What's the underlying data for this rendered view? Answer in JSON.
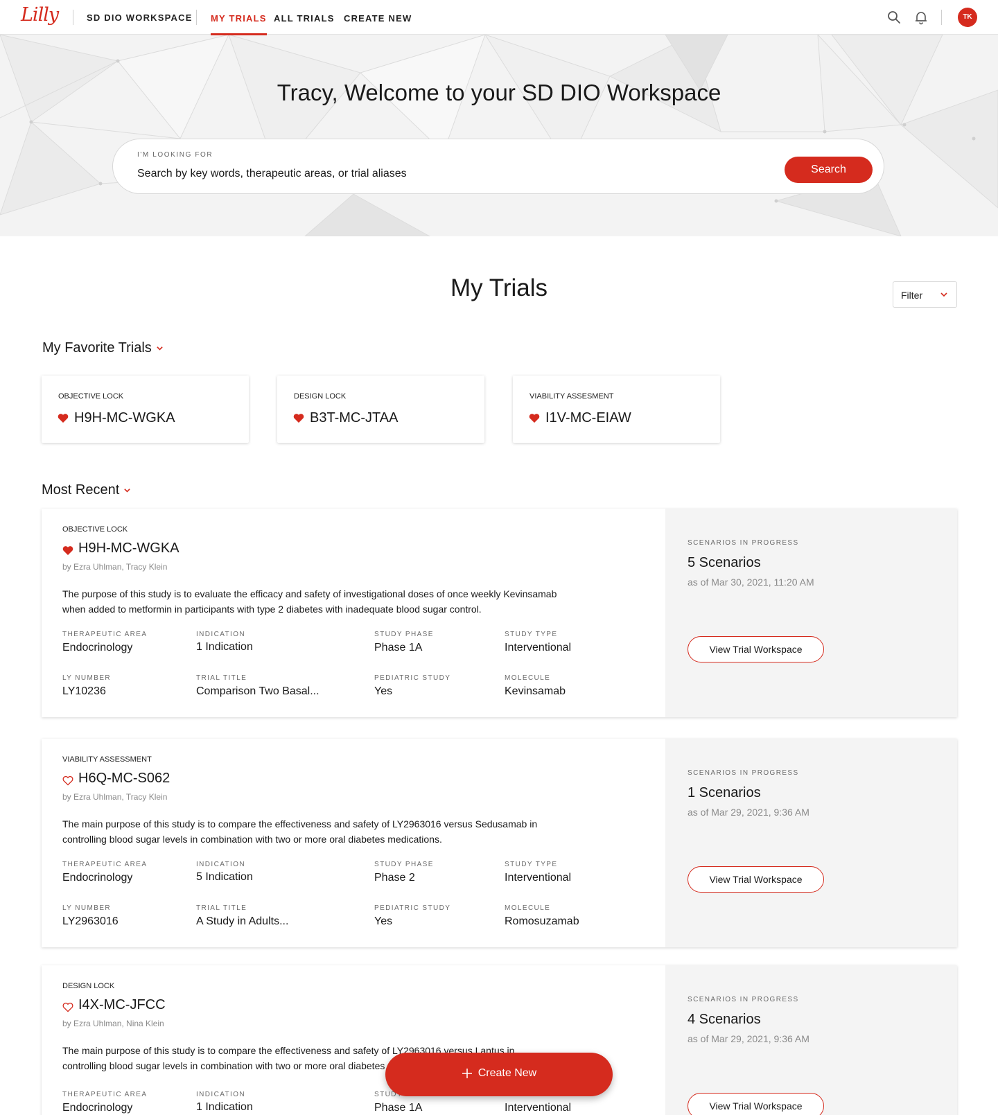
{
  "nav": {
    "logo": "Lilly",
    "workspace": "SD DIO WORKSPACE",
    "links": [
      "MY TRIALS",
      "ALL TRIALS",
      "CREATE NEW"
    ],
    "avatar": "TK"
  },
  "hero": {
    "title": "Tracy, Welcome to your SD DIO Workspace",
    "search_label": "I'M LOOKING FOR",
    "search_placeholder": "Search by key words, therapeutic areas, or trial aliases",
    "search_button": "Search"
  },
  "section": {
    "title": "My Trials",
    "filter": "Filter",
    "favorites_heading": "My Favorite Trials",
    "recent_heading": "Most Recent"
  },
  "favorites": [
    {
      "status": "OBJECTIVE LOCK",
      "id": "H9H-MC-WGKA"
    },
    {
      "status": "DESIGN LOCK",
      "id": "B3T-MC-JTAA"
    },
    {
      "status": "VIABILITY ASSESMENT",
      "id": "I1V-MC-EIAW"
    }
  ],
  "labels": {
    "therapeutic_area": "THERAPEUTIC AREA",
    "indication": "INDICATION",
    "study_phase": "STUDY PHASE",
    "study_type": "STUDY TYPE",
    "ly_number": "LY NUMBER",
    "trial_title": "TRIAL TITLE",
    "pediatric_study": "PEDIATRIC STUDY",
    "molecule": "MOLECULE",
    "scenarios": "SCENARIOS IN PROGRESS",
    "view_button": "View Trial Workspace"
  },
  "trials": [
    {
      "status": "OBJECTIVE LOCK",
      "id": "H9H-MC-WGKA",
      "favorite": true,
      "by": "by Ezra Uhlman, Tracy Klein",
      "desc1": "The purpose of this study is to evaluate the efficacy and safety of investigational doses of once weekly Kevinsamab",
      "desc2": "when added to metformin in participants with type 2 diabetes with inadequate blood sugar control.",
      "therapeutic_area": "Endocrinology",
      "indication": "1 Indication",
      "study_phase": "Phase 1A",
      "study_type": "Interventional",
      "ly_number": "LY10236",
      "trial_title": "Comparison Two Basal...",
      "pediatric_study": "Yes",
      "molecule": "Kevinsamab",
      "scenarios": "5 Scenarios",
      "as_of": "as of Mar 30, 2021, 11:20 AM"
    },
    {
      "status": "VIABILITY ASSESSMENT",
      "id": "H6Q-MC-S062",
      "favorite": false,
      "by": "by Ezra Uhlman, Tracy Klein",
      "desc1": "The main purpose of this study is to compare the effectiveness and safety of LY2963016 versus Sedusamab in",
      "desc2": "controlling blood sugar levels in combination with two or more oral diabetes medications.",
      "therapeutic_area": "Endocrinology",
      "indication": "5 Indication",
      "study_phase": "Phase 2",
      "study_type": "Interventional",
      "ly_number": "LY2963016",
      "trial_title": "A Study in Adults...",
      "pediatric_study": "Yes",
      "molecule": "Romosuzamab",
      "scenarios": "1 Scenarios",
      "as_of": "as of Mar 29, 2021, 9:36 AM"
    },
    {
      "status": "DESIGN LOCK",
      "id": "I4X-MC-JFCC",
      "favorite": false,
      "by": "by Ezra Uhlman, Nina Klein",
      "desc1": "The main purpose of this study is to compare the effectiveness and safety of LY2963016 versus Lantus in",
      "desc2": "controlling blood sugar levels in combination with two or more oral diabetes medications.",
      "therapeutic_area": "Endocrinology",
      "indication": "1 Indication",
      "study_phase": "Phase 1A",
      "study_type": "Interventional",
      "ly_number": "",
      "trial_title": "",
      "pediatric_study": "",
      "molecule": "",
      "scenarios": "4 Scenarios",
      "as_of": "as of Mar 29, 2021, 9:36 AM"
    }
  ],
  "fab": {
    "label": "Create New"
  },
  "colors": {
    "accent": "#d52b1e",
    "panel": "#f4f4f4"
  }
}
